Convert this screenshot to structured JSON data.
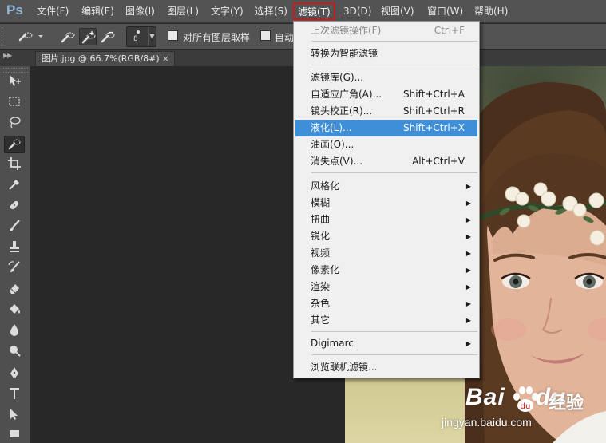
{
  "app": {
    "logo": "Ps"
  },
  "menubar": {
    "items": [
      {
        "label": "文件(F)"
      },
      {
        "label": "编辑(E)"
      },
      {
        "label": "图像(I)"
      },
      {
        "label": "图层(L)"
      },
      {
        "label": "文字(Y)"
      },
      {
        "label": "选择(S)"
      },
      {
        "label": "滤镜(T)",
        "active": true
      },
      {
        "label": "3D(D)"
      },
      {
        "label": "视图(V)"
      },
      {
        "label": "窗口(W)"
      },
      {
        "label": "帮助(H)"
      }
    ]
  },
  "options_bar": {
    "brush_size": "8",
    "sample_all_layers_label": "对所有图层取样",
    "auto_enhance_label": "自动"
  },
  "document_tab": {
    "title": "图片.jpg @ 66.7%(RGB/8#)",
    "close": "×"
  },
  "filter_menu": {
    "items": [
      {
        "label": "上次滤镜操作(F)",
        "shortcut": "Ctrl+F",
        "disabled": true
      },
      {
        "separator": true
      },
      {
        "label": "转换为智能滤镜"
      },
      {
        "separator": true
      },
      {
        "label": "滤镜库(G)..."
      },
      {
        "label": "自适应广角(A)...",
        "shortcut": "Shift+Ctrl+A"
      },
      {
        "label": "镜头校正(R)...",
        "shortcut": "Shift+Ctrl+R"
      },
      {
        "label": "液化(L)...",
        "shortcut": "Shift+Ctrl+X",
        "highlighted": true
      },
      {
        "label": "油画(O)..."
      },
      {
        "label": "消失点(V)...",
        "shortcut": "Alt+Ctrl+V"
      },
      {
        "separator": true
      },
      {
        "label": "风格化",
        "submenu": true
      },
      {
        "label": "模糊",
        "submenu": true
      },
      {
        "label": "扭曲",
        "submenu": true
      },
      {
        "label": "锐化",
        "submenu": true
      },
      {
        "label": "视频",
        "submenu": true
      },
      {
        "label": "像素化",
        "submenu": true
      },
      {
        "label": "渲染",
        "submenu": true
      },
      {
        "label": "杂色",
        "submenu": true
      },
      {
        "label": "其它",
        "submenu": true
      },
      {
        "separator": true
      },
      {
        "label": "Digimarc",
        "submenu": true
      },
      {
        "separator": true
      },
      {
        "label": "浏览联机滤镜..."
      }
    ]
  },
  "watermark": {
    "brand": "Bai",
    "brand2": "du",
    "service": "经验",
    "url": "jingyan.baidu.com"
  },
  "colors": {
    "menu_highlight": "#3f8fd8",
    "active_menu_outline": "#d01818",
    "logo": "#8fb4d8"
  }
}
